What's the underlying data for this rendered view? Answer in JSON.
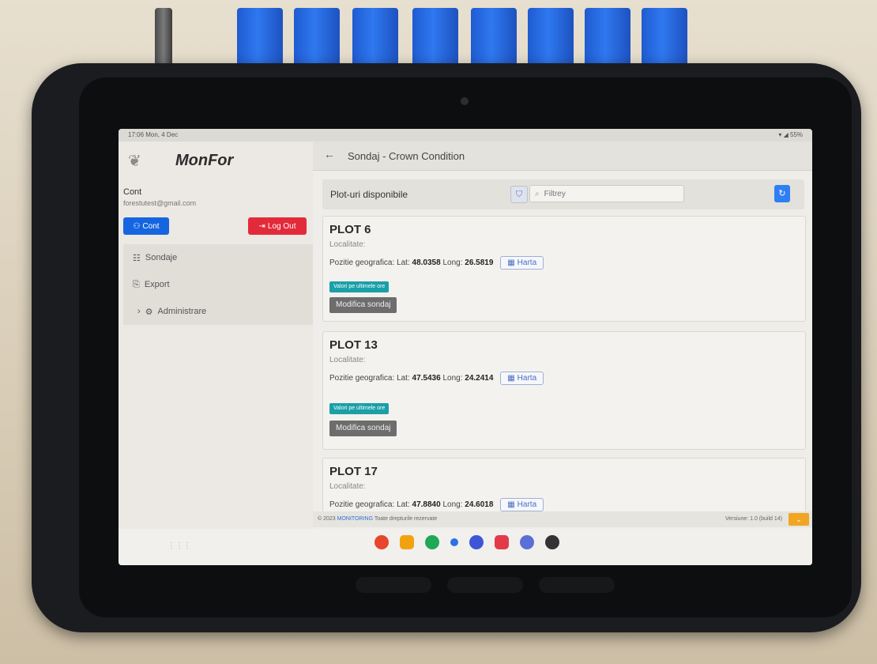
{
  "device": {
    "status_time": "17:06 Mon, 4 Dec",
    "status_right": "▾ ◢ 55%"
  },
  "sidebar": {
    "app_name": "MonFor",
    "account_title": "Cont",
    "account_email": "forestutest@gmail.com",
    "cont_button": "Cont",
    "logout_button": "Log Out",
    "menu": [
      {
        "label": "Sondaje",
        "icon": "clipboard-icon"
      },
      {
        "label": "Export",
        "icon": "export-icon"
      },
      {
        "label": "Administrare",
        "icon": "gear-icon"
      }
    ]
  },
  "header": {
    "title": "Sondaj - Crown Condition"
  },
  "list": {
    "title": "Plot-uri disponibile",
    "search_placeholder": "Filtrey"
  },
  "plots": [
    {
      "name": "PLOT 6",
      "locality_label": "Localitate:",
      "position_label": "Pozitie geografica:",
      "lat_label": "Lat:",
      "lat": "48.0358",
      "long_label": "Long:",
      "long": "26.5819",
      "map_button": "Harta",
      "time_badge": "Valori pe ultimele ore",
      "edit_button": "Modifica sondaj"
    },
    {
      "name": "PLOT 13",
      "locality_label": "Localitate:",
      "position_label": "Pozitie geografica:",
      "lat_label": "Lat:",
      "lat": "47.5436",
      "long_label": "Long:",
      "long": "24.2414",
      "map_button": "Harta",
      "time_badge": "Valori pe ultimele ore",
      "edit_button": "Modifica sondaj"
    },
    {
      "name": "PLOT 17",
      "locality_label": "Localitate:",
      "position_label": "Pozitie geografica:",
      "lat_label": "Lat:",
      "lat": "47.8840",
      "long_label": "Long:",
      "long": "24.6018",
      "map_button": "Harta"
    }
  ],
  "footer": {
    "left_prefix": "© 2023",
    "left_link": "MONITORING",
    "left_suffix": "Toate drepturile rezervate",
    "right": "Versiune: 1.0 (build 14)"
  },
  "colors": {
    "primary": "#1565e0",
    "danger": "#e32a3a",
    "teal_badge": "#1aa0a8",
    "edit_button": "#6d6d6d",
    "footer_chevron": "#f0a623"
  }
}
